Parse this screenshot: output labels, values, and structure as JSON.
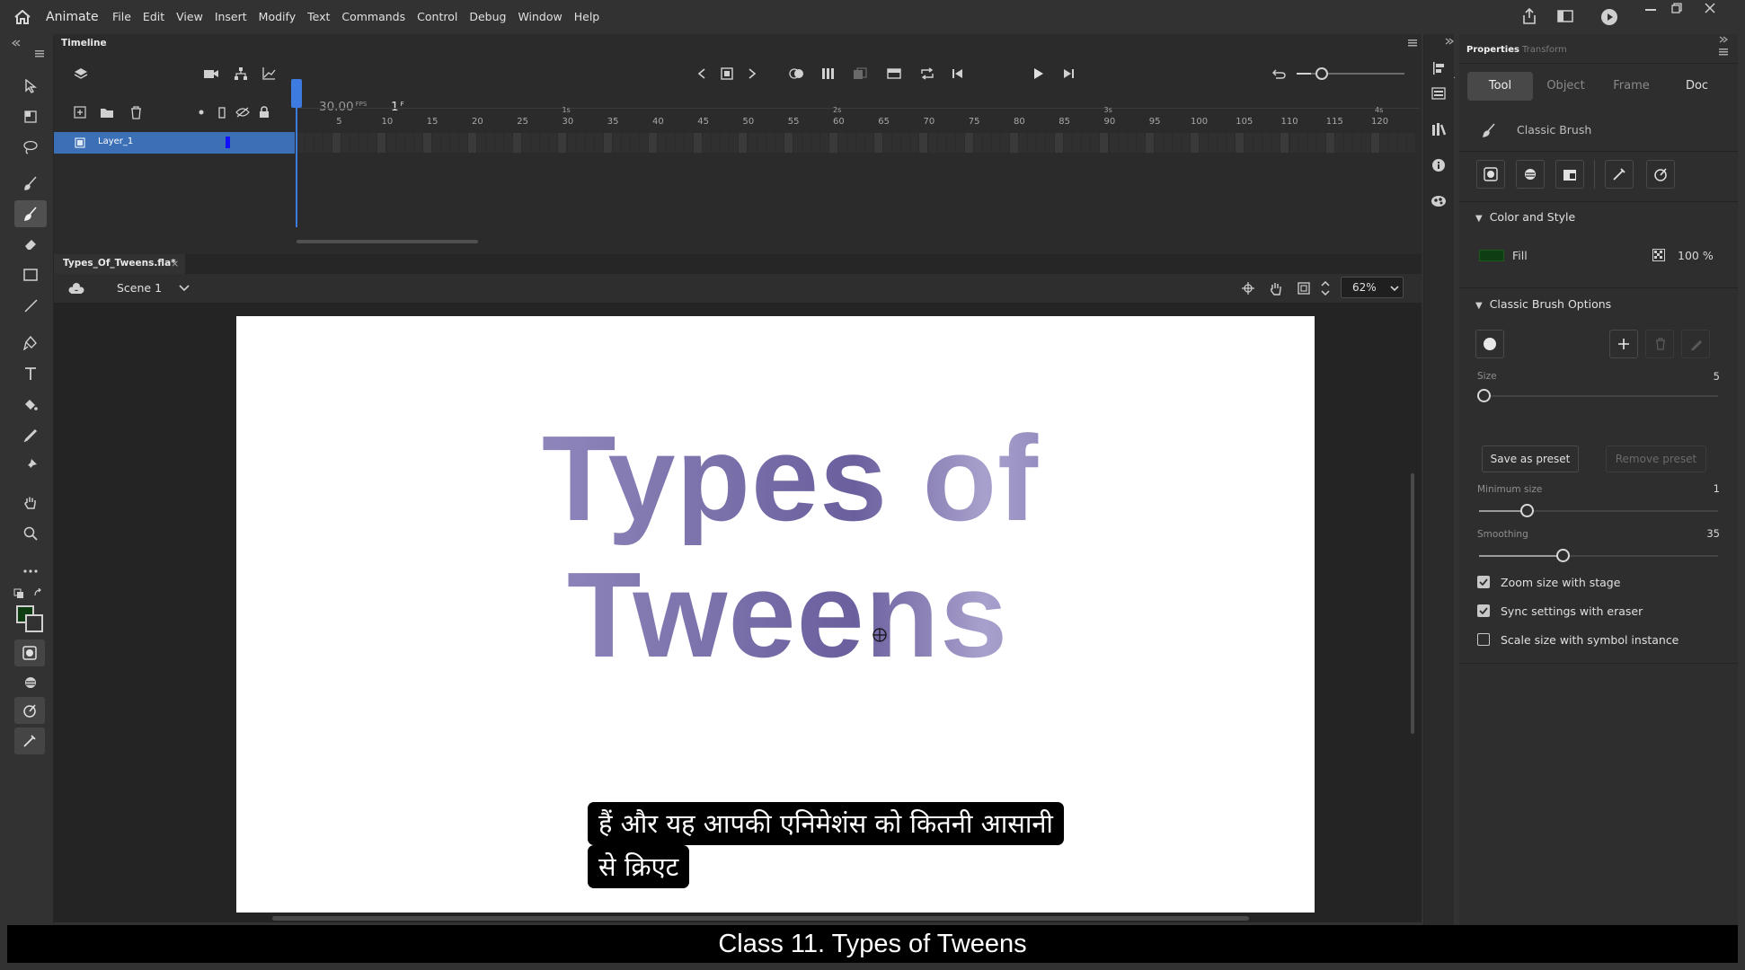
{
  "app": {
    "name": "Animate",
    "menu": [
      "File",
      "Edit",
      "View",
      "Insert",
      "Modify",
      "Text",
      "Commands",
      "Control",
      "Debug",
      "Window",
      "Help"
    ]
  },
  "timeline": {
    "tab_label": "Timeline",
    "fps": "30.00",
    "fps_unit": "FPS",
    "current_frame": "1",
    "frame_unit": "F",
    "second_markers": [
      "1s",
      "2s",
      "3s",
      "4s"
    ],
    "frame_ticks": [
      "5",
      "10",
      "15",
      "20",
      "25",
      "30",
      "35",
      "40",
      "45",
      "50",
      "55",
      "60",
      "65",
      "70",
      "75",
      "80",
      "85",
      "90",
      "95",
      "100",
      "105",
      "110",
      "115",
      "120"
    ],
    "layers": [
      {
        "name": "Layer_1"
      }
    ]
  },
  "document": {
    "tab_label": "Types_Of_Tweens.fla*",
    "tab_close": "×",
    "scene": "Scene 1",
    "zoom": "62%",
    "stage_text_line1": "Types of",
    "stage_text_line2": "Tweens"
  },
  "caption": {
    "line1": "हैं और यह आपकी एनिमेशंस को कितनी आसानी",
    "line2": "से क्रिएट"
  },
  "video_title": "Class 11. Types of Tweens",
  "properties": {
    "tabs": [
      "Properties",
      "Transform"
    ],
    "segments": [
      "Tool",
      "Object",
      "Frame",
      "Doc"
    ],
    "active_segment": "Tool",
    "tool_name": "Classic Brush",
    "color_section": "Color and Style",
    "fill_label": "Fill",
    "fill_color": "#0d3d10",
    "fill_alpha": "100 %",
    "brush_section": "Classic Brush Options",
    "size_label": "Size",
    "size_value": "5",
    "size_fraction": 0.02,
    "save_preset": "Save as preset",
    "remove_preset": "Remove preset",
    "min_size_label": "Minimum size",
    "min_size_value": "1",
    "min_size_fraction": 0.2,
    "smoothing_label": "Smoothing",
    "smoothing_value": "35",
    "smoothing_fraction": 0.35,
    "checkboxes": [
      {
        "label": "Zoom size with stage",
        "checked": true
      },
      {
        "label": "Sync settings with eraser",
        "checked": true
      },
      {
        "label": "Scale size with symbol instance",
        "checked": false
      }
    ]
  }
}
